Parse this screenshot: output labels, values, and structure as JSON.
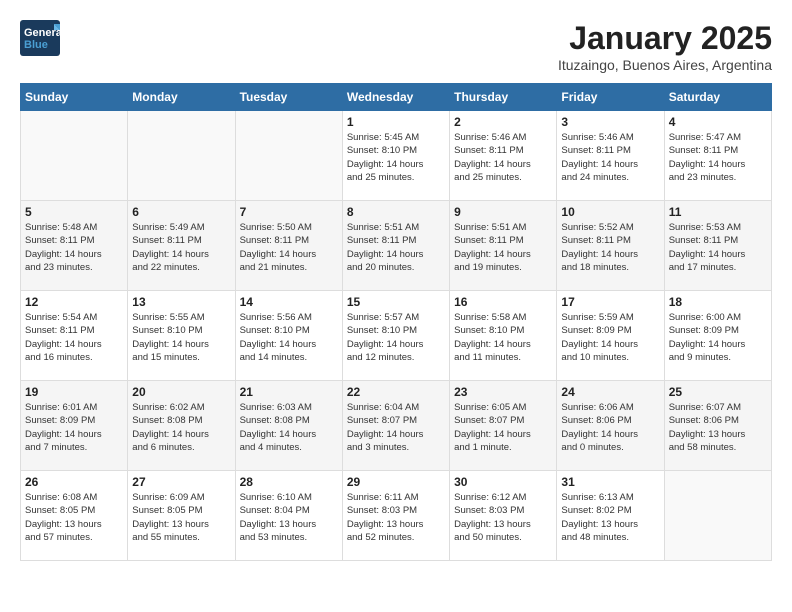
{
  "header": {
    "logo_line1": "General",
    "logo_line2": "Blue",
    "title": "January 2025",
    "subtitle": "Ituzaingo, Buenos Aires, Argentina"
  },
  "weekdays": [
    "Sunday",
    "Monday",
    "Tuesday",
    "Wednesday",
    "Thursday",
    "Friday",
    "Saturday"
  ],
  "weeks": [
    [
      {
        "day": "",
        "info": ""
      },
      {
        "day": "",
        "info": ""
      },
      {
        "day": "",
        "info": ""
      },
      {
        "day": "1",
        "info": "Sunrise: 5:45 AM\nSunset: 8:10 PM\nDaylight: 14 hours\nand 25 minutes."
      },
      {
        "day": "2",
        "info": "Sunrise: 5:46 AM\nSunset: 8:11 PM\nDaylight: 14 hours\nand 25 minutes."
      },
      {
        "day": "3",
        "info": "Sunrise: 5:46 AM\nSunset: 8:11 PM\nDaylight: 14 hours\nand 24 minutes."
      },
      {
        "day": "4",
        "info": "Sunrise: 5:47 AM\nSunset: 8:11 PM\nDaylight: 14 hours\nand 23 minutes."
      }
    ],
    [
      {
        "day": "5",
        "info": "Sunrise: 5:48 AM\nSunset: 8:11 PM\nDaylight: 14 hours\nand 23 minutes."
      },
      {
        "day": "6",
        "info": "Sunrise: 5:49 AM\nSunset: 8:11 PM\nDaylight: 14 hours\nand 22 minutes."
      },
      {
        "day": "7",
        "info": "Sunrise: 5:50 AM\nSunset: 8:11 PM\nDaylight: 14 hours\nand 21 minutes."
      },
      {
        "day": "8",
        "info": "Sunrise: 5:51 AM\nSunset: 8:11 PM\nDaylight: 14 hours\nand 20 minutes."
      },
      {
        "day": "9",
        "info": "Sunrise: 5:51 AM\nSunset: 8:11 PM\nDaylight: 14 hours\nand 19 minutes."
      },
      {
        "day": "10",
        "info": "Sunrise: 5:52 AM\nSunset: 8:11 PM\nDaylight: 14 hours\nand 18 minutes."
      },
      {
        "day": "11",
        "info": "Sunrise: 5:53 AM\nSunset: 8:11 PM\nDaylight: 14 hours\nand 17 minutes."
      }
    ],
    [
      {
        "day": "12",
        "info": "Sunrise: 5:54 AM\nSunset: 8:11 PM\nDaylight: 14 hours\nand 16 minutes."
      },
      {
        "day": "13",
        "info": "Sunrise: 5:55 AM\nSunset: 8:10 PM\nDaylight: 14 hours\nand 15 minutes."
      },
      {
        "day": "14",
        "info": "Sunrise: 5:56 AM\nSunset: 8:10 PM\nDaylight: 14 hours\nand 14 minutes."
      },
      {
        "day": "15",
        "info": "Sunrise: 5:57 AM\nSunset: 8:10 PM\nDaylight: 14 hours\nand 12 minutes."
      },
      {
        "day": "16",
        "info": "Sunrise: 5:58 AM\nSunset: 8:10 PM\nDaylight: 14 hours\nand 11 minutes."
      },
      {
        "day": "17",
        "info": "Sunrise: 5:59 AM\nSunset: 8:09 PM\nDaylight: 14 hours\nand 10 minutes."
      },
      {
        "day": "18",
        "info": "Sunrise: 6:00 AM\nSunset: 8:09 PM\nDaylight: 14 hours\nand 9 minutes."
      }
    ],
    [
      {
        "day": "19",
        "info": "Sunrise: 6:01 AM\nSunset: 8:09 PM\nDaylight: 14 hours\nand 7 minutes."
      },
      {
        "day": "20",
        "info": "Sunrise: 6:02 AM\nSunset: 8:08 PM\nDaylight: 14 hours\nand 6 minutes."
      },
      {
        "day": "21",
        "info": "Sunrise: 6:03 AM\nSunset: 8:08 PM\nDaylight: 14 hours\nand 4 minutes."
      },
      {
        "day": "22",
        "info": "Sunrise: 6:04 AM\nSunset: 8:07 PM\nDaylight: 14 hours\nand 3 minutes."
      },
      {
        "day": "23",
        "info": "Sunrise: 6:05 AM\nSunset: 8:07 PM\nDaylight: 14 hours\nand 1 minute."
      },
      {
        "day": "24",
        "info": "Sunrise: 6:06 AM\nSunset: 8:06 PM\nDaylight: 14 hours\nand 0 minutes."
      },
      {
        "day": "25",
        "info": "Sunrise: 6:07 AM\nSunset: 8:06 PM\nDaylight: 13 hours\nand 58 minutes."
      }
    ],
    [
      {
        "day": "26",
        "info": "Sunrise: 6:08 AM\nSunset: 8:05 PM\nDaylight: 13 hours\nand 57 minutes."
      },
      {
        "day": "27",
        "info": "Sunrise: 6:09 AM\nSunset: 8:05 PM\nDaylight: 13 hours\nand 55 minutes."
      },
      {
        "day": "28",
        "info": "Sunrise: 6:10 AM\nSunset: 8:04 PM\nDaylight: 13 hours\nand 53 minutes."
      },
      {
        "day": "29",
        "info": "Sunrise: 6:11 AM\nSunset: 8:03 PM\nDaylight: 13 hours\nand 52 minutes."
      },
      {
        "day": "30",
        "info": "Sunrise: 6:12 AM\nSunset: 8:03 PM\nDaylight: 13 hours\nand 50 minutes."
      },
      {
        "day": "31",
        "info": "Sunrise: 6:13 AM\nSunset: 8:02 PM\nDaylight: 13 hours\nand 48 minutes."
      },
      {
        "day": "",
        "info": ""
      }
    ]
  ]
}
